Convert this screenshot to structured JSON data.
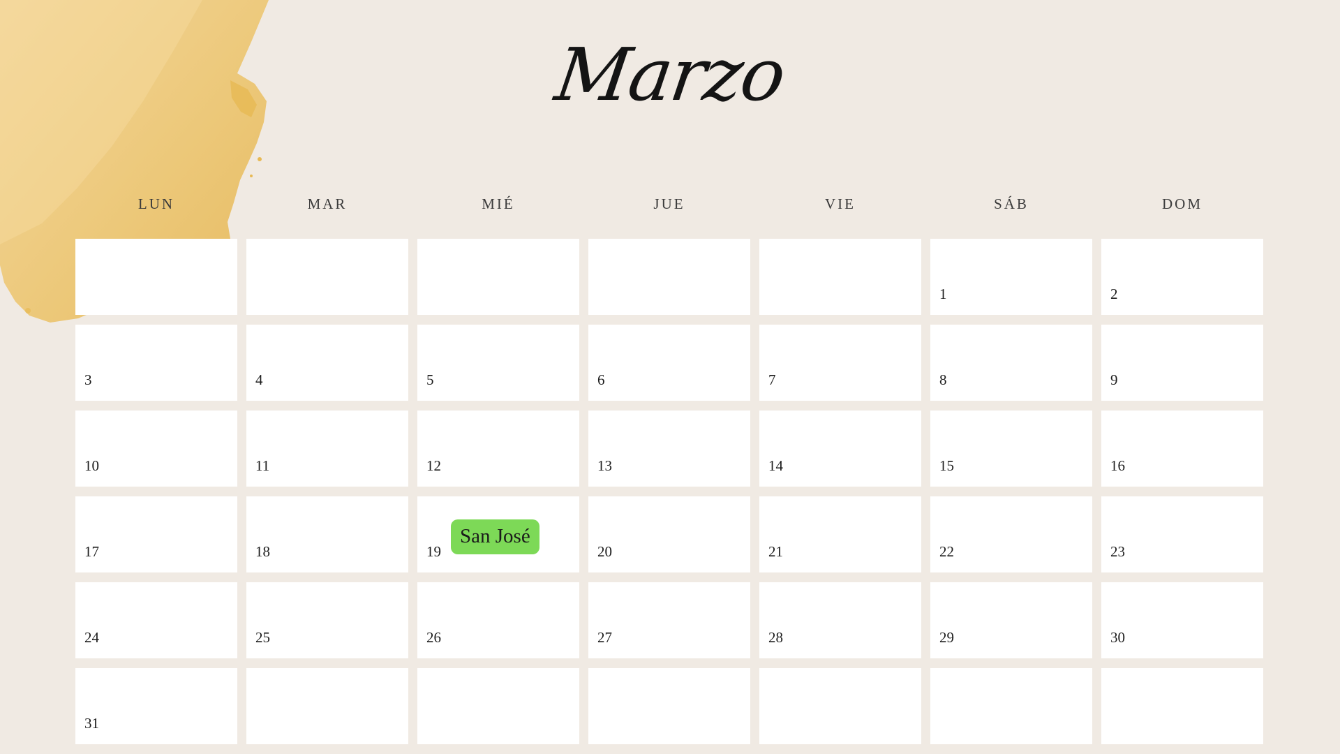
{
  "calendar": {
    "month": "Marzo",
    "weekdays": [
      "LUN",
      "MAR",
      "MIÉ",
      "JUE",
      "VIE",
      "SÁB",
      "DOM"
    ],
    "days": [
      "",
      "",
      "",
      "",
      "",
      "1",
      "2",
      "3",
      "4",
      "5",
      "6",
      "7",
      "8",
      "9",
      "10",
      "11",
      "12",
      "13",
      "14",
      "15",
      "16",
      "17",
      "18",
      "19",
      "20",
      "21",
      "22",
      "23",
      "24",
      "25",
      "26",
      "27",
      "28",
      "29",
      "30",
      "31",
      "",
      "",
      "",
      "",
      "",
      ""
    ],
    "events": [
      {
        "day": "19",
        "label": "San José",
        "color": "#7dd957"
      }
    ]
  },
  "colors": {
    "background": "#f0eae3",
    "cell": "#ffffff",
    "watercolor": "#e9bd5c",
    "event": "#7dd957"
  }
}
